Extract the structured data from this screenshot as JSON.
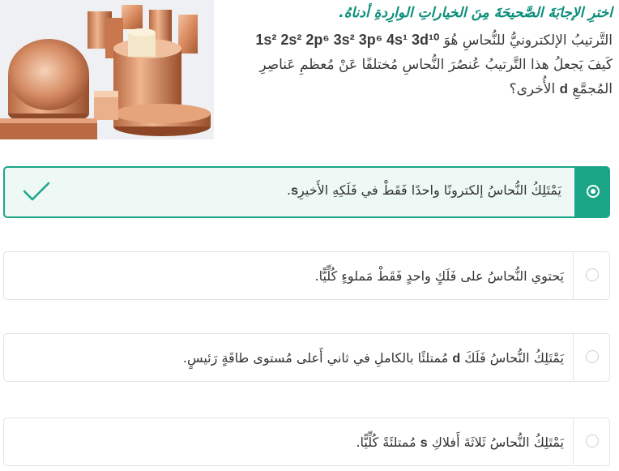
{
  "question": {
    "instruction": "اخترِ الإجابَةَ الصَّحيحَةَ مِنَ الخياراتِ الوارِدةِ أدناهُ.",
    "line1_prefix": "التَّرتيبُ الإلكترونيُّ للنُّحاسِ هُوَ",
    "config": "1s² 2s² 2p⁶ 3s² 3p⁶ 4s¹ 3d¹⁰",
    "line2": "كَيفَ يَجعلُ هذا التَّرتيبُ عُنصُرَ النُّحاسِ مُختلفًا عَنْ مُعظمِ عَناصِرِ",
    "line3_prefix": "المُجمَّعِ",
    "line3_d": "d",
    "line3_suffix": "الأُخرى؟"
  },
  "options": [
    {
      "text_before": "يَمْتَلِكُ النُّحاسُ إلكترونًا واحدًا فَقَطْ في فَلَكِهِ الأَخيرِ",
      "bold": "s",
      "text_after": ".",
      "selected": true,
      "correct": true
    },
    {
      "text_before": "يَحتوي النُّحاسُ على فَلَكٍ واحدٍ فَقَطْ مَملوءٍ كُلِّيًّا.",
      "bold": "",
      "text_after": "",
      "selected": false,
      "correct": false
    },
    {
      "text_before": "يَمْتَلِكُ النُّحاسُ فَلَكَ",
      "bold": "d",
      "text_after": "مُمتلئًا بالكاملِ في ثاني أَعلى مُستوى طاقَةٍ رَئيسٍ.",
      "selected": false,
      "correct": false
    },
    {
      "text_before": "يَمْتَلِكُ النُّحاسُ ثَلاثَةَ أَفلاكِ",
      "bold": "s",
      "text_after": "مُمتلئَةً كُلِّيًّا.",
      "selected": false,
      "correct": false
    }
  ],
  "colors": {
    "accent": "#1ba587",
    "instruction": "#0b8f7a"
  },
  "icons": {
    "selected_radio": "radio-checked-icon",
    "correct": "checkmark-icon"
  }
}
